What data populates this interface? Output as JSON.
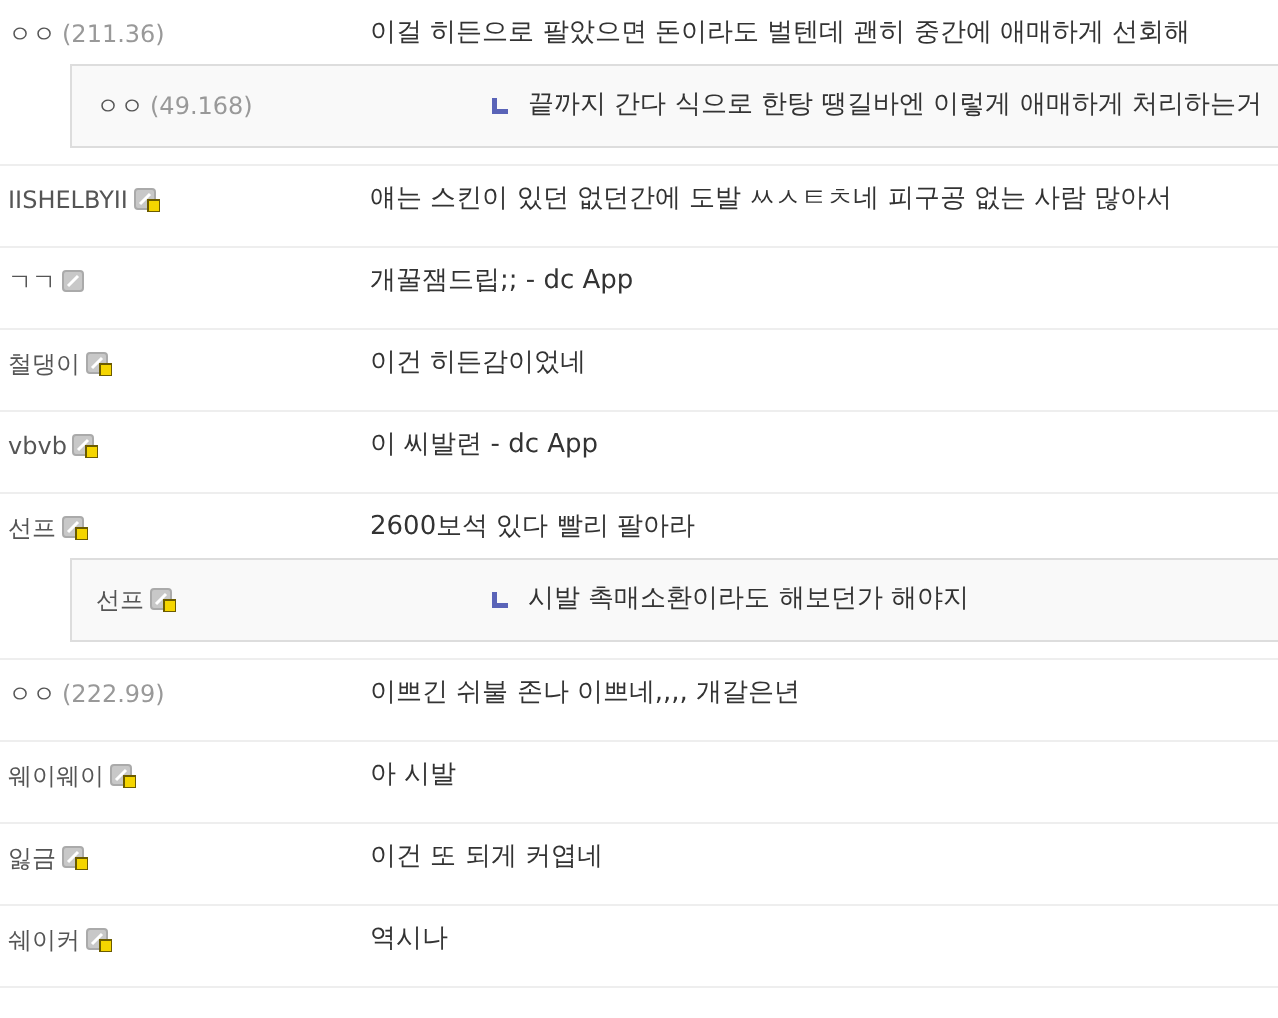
{
  "comments": [
    {
      "nick": "ㅇㅇ",
      "ip": "(211.36)",
      "text": "이걸 히든으로 팔았으면 돈이라도 벌텐데 괜히 중간에 애매하게 선회해",
      "replies": [
        {
          "nick": "ㅇㅇ",
          "ip": "(49.168)",
          "text": "끝까지 간다 식으로 한탕 땡길바엔 이렇게 애매하게 처리하는거"
        }
      ]
    },
    {
      "nick": "IISHELBYII",
      "fixed_nick": true,
      "text": "얘는 스킨이 있던 없던간에 도발 ㅆㅅㅌㅊ네 피구공 없는 사람 많아서"
    },
    {
      "nick": "ㄱㄱ",
      "fixed_nick": false,
      "text": "개꿀잼드립;; - dc App"
    },
    {
      "nick": "철댕이",
      "fixed_nick": true,
      "text": "이건 히든감이었네"
    },
    {
      "nick": "vbvb",
      "fixed_nick": true,
      "text": "이 씨발련 - dc App"
    },
    {
      "nick": "선프",
      "fixed_nick": true,
      "text": "2600보석 있다 빨리 팔아라",
      "replies": [
        {
          "nick": "선프",
          "fixed_nick": true,
          "text": "시발 촉매소환이라도 해보던가 해야지"
        }
      ]
    },
    {
      "nick": "ㅇㅇ",
      "ip": "(222.99)",
      "text": "이쁘긴 쉬불 존나 이쁘네,,,, 개갈은년"
    },
    {
      "nick": "웨이웨이",
      "fixed_nick": true,
      "text": "아 시발"
    },
    {
      "nick": "잃금",
      "fixed_nick": true,
      "text": "이건 또 되게 커엽네"
    },
    {
      "nick": "쉐이커",
      "fixed_nick": true,
      "text": "역시나"
    }
  ]
}
